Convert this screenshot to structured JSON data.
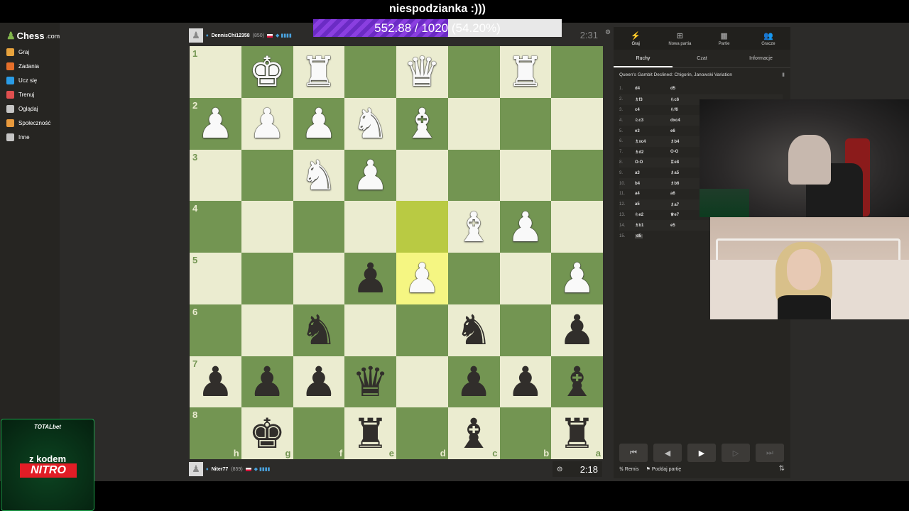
{
  "stream_title": "niespodzianka :)))",
  "goal": {
    "text": "552.88 / 1020 (54.20%)",
    "fraction": 0.542
  },
  "sidebar": {
    "logo": "Chess",
    "logo_domain": ".com",
    "items": [
      {
        "label": "Graj",
        "icon": "play-icon",
        "color": "#e8a33d"
      },
      {
        "label": "Zadania",
        "icon": "puzzle-icon",
        "color": "#e66f2a"
      },
      {
        "label": "Ucz się",
        "icon": "learn-icon",
        "color": "#2a9ce6"
      },
      {
        "label": "Trenuj",
        "icon": "train-icon",
        "color": "#e04f4f"
      },
      {
        "label": "Oglądaj",
        "icon": "binoculars-icon",
        "color": "#c5c5c5"
      },
      {
        "label": "Społeczność",
        "icon": "community-icon",
        "color": "#e89a3d"
      },
      {
        "label": "Inne",
        "icon": "more-icon",
        "color": "#c5c5c5"
      }
    ]
  },
  "top_player": {
    "name": "DennisChi12358",
    "rating": "(850)",
    "clock": "2:31"
  },
  "bottom_player": {
    "name": "Niter77",
    "rating": "(859)",
    "clock": "2:18"
  },
  "board": {
    "orientation": "black",
    "ranks": [
      "1",
      "2",
      "3",
      "4",
      "5",
      "6",
      "7",
      "8"
    ],
    "files": [
      "h",
      "g",
      "f",
      "e",
      "d",
      "c",
      "b",
      "a"
    ],
    "rows": [
      [
        "",
        "wK",
        "wR",
        "",
        "wQ",
        "",
        "wR",
        ""
      ],
      [
        "wP",
        "wP",
        "wP",
        "wN",
        "wB",
        "",
        "",
        ""
      ],
      [
        "",
        "",
        "wN",
        "wP",
        "",
        "",
        "",
        ""
      ],
      [
        "",
        "",
        "",
        "",
        "",
        "wB",
        "wP",
        ""
      ],
      [
        "",
        "",
        "",
        "bP",
        "wP",
        "",
        "",
        "wP"
      ],
      [
        "",
        "",
        "bN",
        "",
        "",
        "bN",
        "",
        "bP"
      ],
      [
        "bP",
        "bP",
        "bP",
        "bQ",
        "",
        "bP",
        "bP",
        "bB"
      ],
      [
        "",
        "bK",
        "",
        "bR",
        "",
        "bB",
        "",
        "bR"
      ]
    ],
    "last_move": [
      "d4",
      "d5"
    ]
  },
  "panel": {
    "tabs": [
      {
        "label": "Graj",
        "icon": "bolt-icon"
      },
      {
        "label": "Nowa partia",
        "icon": "plus-icon"
      },
      {
        "label": "Partie",
        "icon": "board-icon"
      },
      {
        "label": "Gracze",
        "icon": "players-icon"
      }
    ],
    "subtabs": [
      "Ruchy",
      "Czat",
      "Informacje"
    ],
    "opening": "Queen's Gambit Declined: Chigorin, Janowski Variation",
    "moves": [
      {
        "n": "1.",
        "w": "d4",
        "b": "d5"
      },
      {
        "n": "2.",
        "w": "♗f3",
        "b": "♘c6"
      },
      {
        "n": "3.",
        "w": "c4",
        "b": "♘f6"
      },
      {
        "n": "4.",
        "w": "♘c3",
        "b": "dxc4"
      },
      {
        "n": "5.",
        "w": "e3",
        "b": "e6"
      },
      {
        "n": "6.",
        "w": "♗xc4",
        "b": "♗b4"
      },
      {
        "n": "7.",
        "w": "♗d2",
        "b": "O-O"
      },
      {
        "n": "8.",
        "w": "O-O",
        "b": "♖e8"
      },
      {
        "n": "9.",
        "w": "a3",
        "b": "♗a5"
      },
      {
        "n": "10.",
        "w": "b4",
        "b": "♗b6"
      },
      {
        "n": "11.",
        "w": "a4",
        "b": "a6"
      },
      {
        "n": "12.",
        "w": "a5",
        "b": "♗a7"
      },
      {
        "n": "13.",
        "w": "♘e2",
        "b": "♕e7"
      },
      {
        "n": "14.",
        "w": "♗b1",
        "b": "e5"
      },
      {
        "n": "15.",
        "w": "d5",
        "b": ""
      }
    ],
    "draw_label": "Remis",
    "draw_symbol": "½",
    "resign_label": "Poddaj partię"
  },
  "ad": {
    "brand": "TOTALbet",
    "line1": "z kodem",
    "code": "NITRO"
  }
}
